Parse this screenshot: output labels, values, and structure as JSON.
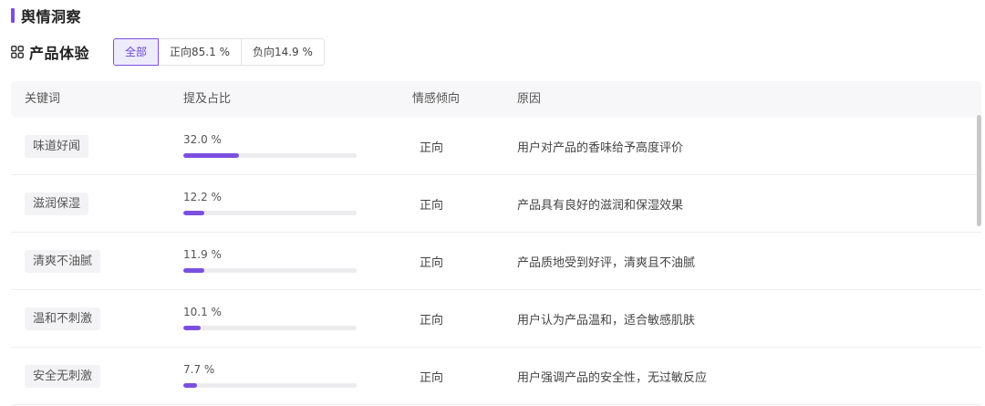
{
  "section": {
    "title": "舆情洞察"
  },
  "subsection": {
    "icon": "grid-icon",
    "title": "产品体验"
  },
  "tabs": [
    {
      "label": "全部",
      "active": true
    },
    {
      "label": "正向85.1 %",
      "active": false
    },
    {
      "label": "负向14.9 %",
      "active": false
    }
  ],
  "table": {
    "headers": {
      "keyword": "关键词",
      "ratio": "提及占比",
      "sentiment": "情感倾向",
      "reason": "原因"
    },
    "rows": [
      {
        "keyword": "味道好闻",
        "percent_label": "32.0 %",
        "percent": 32.0,
        "sentiment": "正向",
        "reason": "用户对产品的香味给予高度评价"
      },
      {
        "keyword": "滋润保湿",
        "percent_label": "12.2 %",
        "percent": 12.2,
        "sentiment": "正向",
        "reason": "产品具有良好的滋润和保湿效果"
      },
      {
        "keyword": "清爽不油腻",
        "percent_label": "11.9 %",
        "percent": 11.9,
        "sentiment": "正向",
        "reason": "产品质地受到好评，清爽且不油腻"
      },
      {
        "keyword": "温和不刺激",
        "percent_label": "10.1 %",
        "percent": 10.1,
        "sentiment": "正向",
        "reason": "用户认为产品温和，适合敏感肌肤"
      },
      {
        "keyword": "安全无刺激",
        "percent_label": "7.7 %",
        "percent": 7.7,
        "sentiment": "正向",
        "reason": "用户强调产品的安全性，无过敏反应"
      }
    ]
  },
  "colors": {
    "accent": "#7b4fe0",
    "accent_bg": "#eeebfb",
    "track": "#ececee",
    "tag_bg": "#f3f3f5",
    "header_bg": "#f7f7f9"
  }
}
